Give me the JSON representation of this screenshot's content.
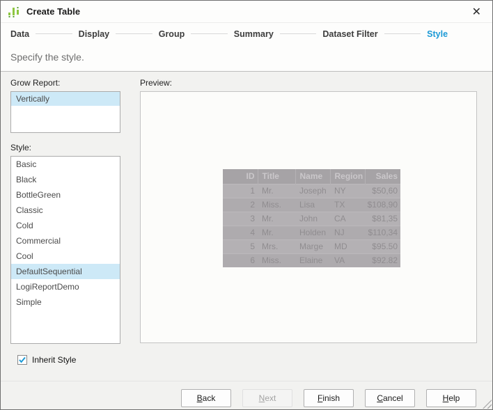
{
  "window": {
    "title": "Create Table",
    "close_glyph": "✕"
  },
  "steps": {
    "items": [
      {
        "label": "Data",
        "active": false
      },
      {
        "label": "Display",
        "active": false
      },
      {
        "label": "Group",
        "active": false
      },
      {
        "label": "Summary",
        "active": false
      },
      {
        "label": "Dataset Filter",
        "active": false
      },
      {
        "label": "Style",
        "active": true
      }
    ]
  },
  "subtitle": "Specify the style.",
  "grow_report": {
    "label": "Grow Report:",
    "options": [
      "Vertically"
    ],
    "selected": "Vertically"
  },
  "style_list": {
    "label": "Style:",
    "options": [
      "Basic",
      "Black",
      "BottleGreen",
      "Classic",
      "Cold",
      "Commercial",
      "Cool",
      "DefaultSequential",
      "LogiReportDemo",
      "Simple"
    ],
    "selected": "DefaultSequential"
  },
  "inherit_style": {
    "label": "Inherit Style",
    "checked": true
  },
  "preview": {
    "label": "Preview:",
    "table": {
      "columns": [
        "ID",
        "Title",
        "Name",
        "Region",
        "Sales"
      ],
      "rows": [
        [
          "1",
          "Mr.",
          "Joseph",
          "NY",
          "$50,60"
        ],
        [
          "2",
          "Miss.",
          "Lisa",
          "TX",
          "$108,90"
        ],
        [
          "3",
          "Mr.",
          "John",
          "CA",
          "$81,35"
        ],
        [
          "4",
          "Mr.",
          "Holden",
          "NJ",
          "$110,34"
        ],
        [
          "5",
          "Mrs.",
          "Marge",
          "MD",
          "$95.50"
        ],
        [
          "6",
          "Miss.",
          "Elaine",
          "VA",
          "$92.82"
        ]
      ]
    }
  },
  "buttons": [
    {
      "label": "Back",
      "mnemonic": "B",
      "enabled": true
    },
    {
      "label": "Next",
      "mnemonic": "N",
      "enabled": false
    },
    {
      "label": "Finish",
      "mnemonic": "F",
      "enabled": true
    },
    {
      "label": "Cancel",
      "mnemonic": "C",
      "enabled": true
    },
    {
      "label": "Help",
      "mnemonic": "H",
      "enabled": true
    }
  ],
  "colors": {
    "accent": "#1c9ad6",
    "selection": "#cde9f7",
    "icon_green": "#8dc63f",
    "icon_green_dark": "#55a02e"
  }
}
